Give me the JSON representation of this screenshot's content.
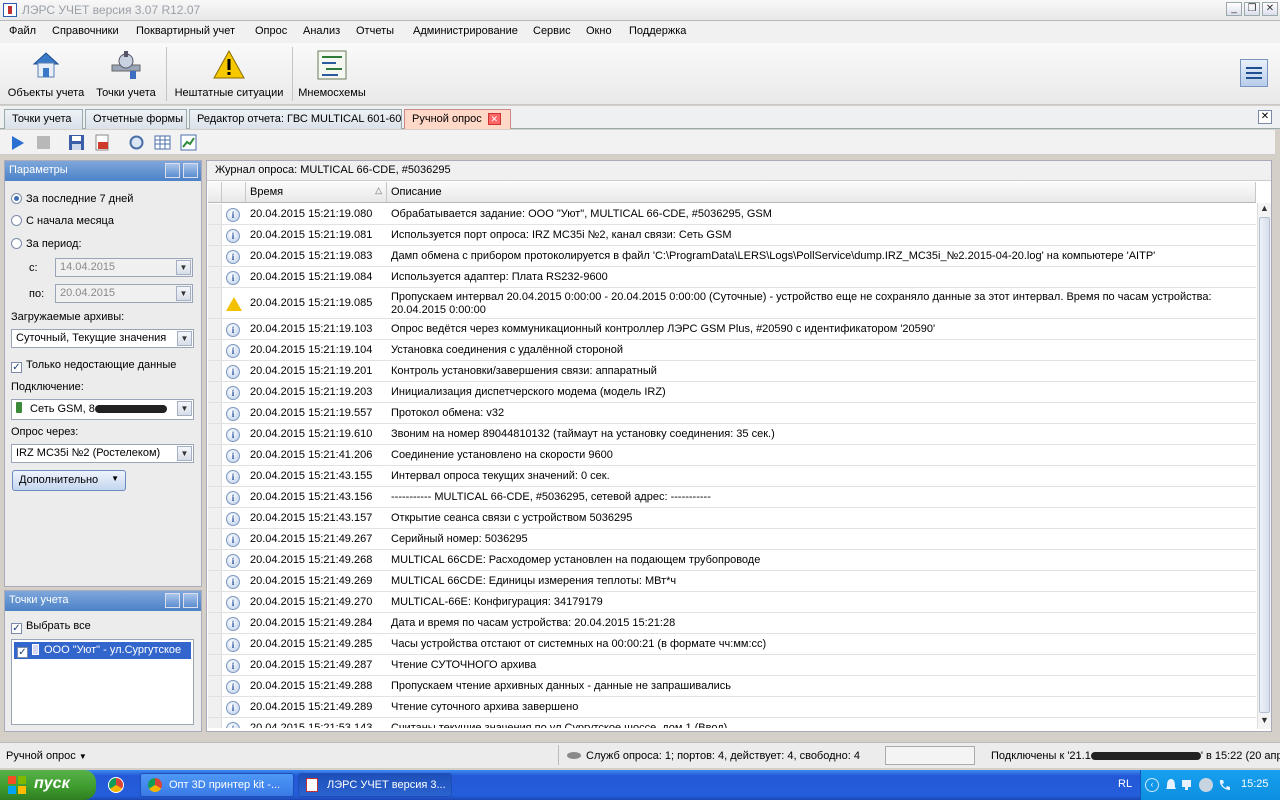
{
  "window": {
    "title": "ЛЭРС УЧЕТ версия 3.07 R12.07"
  },
  "menu": [
    "Файл",
    "Справочники",
    "Поквартирный учет",
    "Опрос",
    "Анализ",
    "Отчеты",
    "Администрирование",
    "Сервис",
    "Окно",
    "Поддержка"
  ],
  "toolbar": {
    "objects": "Объекты учета",
    "points": "Точки учета",
    "alerts": "Нештатные ситуации",
    "schemes": "Мнемосхемы"
  },
  "tabs": [
    {
      "label": "Точки учета"
    },
    {
      "label": "Отчетные формы"
    },
    {
      "label": "Редактор отчета: ГВС MULTICAL 601-60"
    },
    {
      "label": "Ручной опрос"
    }
  ],
  "params": {
    "header": "Параметры",
    "period_last7": "За последние 7 дней",
    "period_month": "С начала месяца",
    "period_range": "За период:",
    "from_label": "с:",
    "from_value": "14.04.2015",
    "to_label": "по:",
    "to_value": "20.04.2015",
    "archives_label": "Загружаемые архивы:",
    "archives_value": "Суточный, Текущие значения",
    "missing_only": "Только недостающие данные",
    "connection_label": "Подключение:",
    "connection_value": "Сеть GSM, 8",
    "via_label": "Опрос через:",
    "via_value": "IRZ MC35i №2 (Ростелеком)",
    "more_button": "Дополнительно"
  },
  "points": {
    "header": "Точки учета",
    "select_all": "Выбрать все",
    "item": "ООО \"Уют\" - ул.Сургутское"
  },
  "journal": {
    "title": "Журнал опроса: MULTICAL 66-CDE, #5036295",
    "col_time": "Время",
    "col_desc": "Описание",
    "rows": [
      {
        "type": "info",
        "time": "20.04.2015 15:21:19.080",
        "desc": "Обрабатывается задание: ООО \"Уют\", MULTICAL 66-CDE, #5036295, GSM"
      },
      {
        "type": "info",
        "time": "20.04.2015 15:21:19.081",
        "desc": "Используется порт опроса: IRZ MC35i №2, канал связи: Сеть GSM"
      },
      {
        "type": "info",
        "time": "20.04.2015 15:21:19.083",
        "desc": "Дамп обмена с прибором протоколируется в файл 'C:\\ProgramData\\LERS\\Logs\\PollService\\dump.IRZ_MC35i_№2.2015-04-20.log' на компьютере 'AITP'"
      },
      {
        "type": "info",
        "time": "20.04.2015 15:21:19.084",
        "desc": "Используется адаптер: Плата RS232-9600"
      },
      {
        "type": "warn",
        "time": "20.04.2015 15:21:19.085",
        "desc": "Пропускаем интервал 20.04.2015 0:00:00 - 20.04.2015 0:00:00 (Суточные) - устройство еще не сохраняло данные за этот интервал. Время по часам устройства: 20.04.2015 0:00:00"
      },
      {
        "type": "info",
        "time": "20.04.2015 15:21:19.103",
        "desc": "Опрос ведётся через коммуникационный контроллер ЛЭРС GSM Plus, #20590 с идентификатором '20590'"
      },
      {
        "type": "info",
        "time": "20.04.2015 15:21:19.104",
        "desc": "Установка соединения с удалённой стороной"
      },
      {
        "type": "info",
        "time": "20.04.2015 15:21:19.201",
        "desc": "Контроль установки/завершения связи: аппаратный"
      },
      {
        "type": "info",
        "time": "20.04.2015 15:21:19.203",
        "desc": "Инициализация диспетчерского модема (модель IRZ)"
      },
      {
        "type": "info",
        "time": "20.04.2015 15:21:19.557",
        "desc": "Протокол обмена: v32"
      },
      {
        "type": "info",
        "time": "20.04.2015 15:21:19.610",
        "desc": "Звоним на номер 89044810132 (таймаут на установку соединения: 35 сек.)"
      },
      {
        "type": "info",
        "time": "20.04.2015 15:21:41.206",
        "desc": "Соединение установлено на скорости 9600"
      },
      {
        "type": "info",
        "time": "20.04.2015 15:21:43.155",
        "desc": "Интервал опроса текущих значений: 0 сек."
      },
      {
        "type": "info",
        "time": "20.04.2015 15:21:43.156",
        "desc": "----------- MULTICAL 66-CDE, #5036295, сетевой адрес:  -----------"
      },
      {
        "type": "info",
        "time": "20.04.2015 15:21:43.157",
        "desc": "Открытие сеанса связи с устройством 5036295"
      },
      {
        "type": "info",
        "time": "20.04.2015 15:21:49.267",
        "desc": "Серийный номер: 5036295"
      },
      {
        "type": "info",
        "time": "20.04.2015 15:21:49.268",
        "desc": "MULTICAL 66CDE: Расходомер установлен на подающем трубопроводе"
      },
      {
        "type": "info",
        "time": "20.04.2015 15:21:49.269",
        "desc": "MULTICAL 66CDE: Единицы измерения теплоты: МВт*ч"
      },
      {
        "type": "info",
        "time": "20.04.2015 15:21:49.270",
        "desc": "MULTICAL-66E: Конфигурация: 34179179"
      },
      {
        "type": "info",
        "time": "20.04.2015 15:21:49.284",
        "desc": "Дата и время по часам устройства: 20.04.2015 15:21:28"
      },
      {
        "type": "info",
        "time": "20.04.2015 15:21:49.285",
        "desc": "Часы устройства отстают от системных на 00:00:21 (в формате чч:мм:сс)"
      },
      {
        "type": "info",
        "time": "20.04.2015 15:21:49.287",
        "desc": "Чтение СУТОЧНОГО архива"
      },
      {
        "type": "info",
        "time": "20.04.2015 15:21:49.288",
        "desc": "Пропускаем чтение архивных данных - данные не запрашивались"
      },
      {
        "type": "info",
        "time": "20.04.2015 15:21:49.289",
        "desc": "Чтение суточного архива завершено"
      },
      {
        "type": "info",
        "time": "20.04.2015 15:21:53.143",
        "desc": "Считаны текущие значения по ул.Сургутское шоссе, дом 1 (Ввод)"
      }
    ]
  },
  "status": {
    "mode": "Ручной опрос",
    "services": "Служб опроса: 1; портов: 4, действует: 4, свободно: 4",
    "connected_prefix": "Подключены к '21.1",
    "connected_suffix": "' в 15:22 (20 апр)"
  },
  "taskbar": {
    "start": "пуск",
    "tasks": [
      "Опт 3D принтер kit -...",
      "ЛЭРС УЧЕТ версия 3..."
    ],
    "lang": "RL",
    "clock": "15:25"
  }
}
